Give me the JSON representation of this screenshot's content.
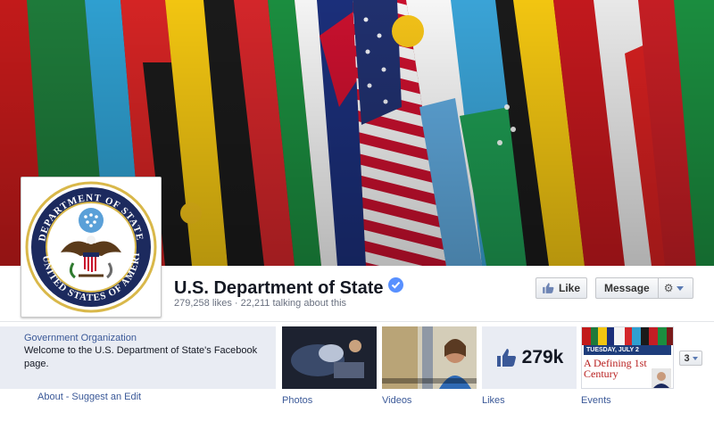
{
  "page": {
    "name": "U.S. Department of State",
    "stats": "279,258 likes · 22,211 talking about this"
  },
  "actions": {
    "like_label": "Like",
    "message_label": "Message"
  },
  "about": {
    "category": "Government Organization",
    "description": "Welcome to the U.S. Department of State's Facebook page.",
    "links": [
      "About",
      "Suggest an Edit"
    ],
    "link_separator": "-"
  },
  "apps": [
    {
      "label": "Photos"
    },
    {
      "label": "Videos"
    },
    {
      "label": "Likes",
      "count": "279k"
    },
    {
      "label": "Events",
      "date_banner": "TUESDAY, JULY 2",
      "title": "A Defining 1st Century"
    }
  ],
  "more_apps": {
    "count": "3"
  },
  "icons": {
    "verified": "verified-badge-icon",
    "like": "thumbs-up-icon",
    "gear": "gear-icon",
    "dropdown": "chevron-down-icon",
    "seal": "department-of-state-seal-logo"
  },
  "colors": {
    "link": "#3b5998",
    "verified": "#5890ff",
    "about_bg": "#e9ecf3"
  }
}
